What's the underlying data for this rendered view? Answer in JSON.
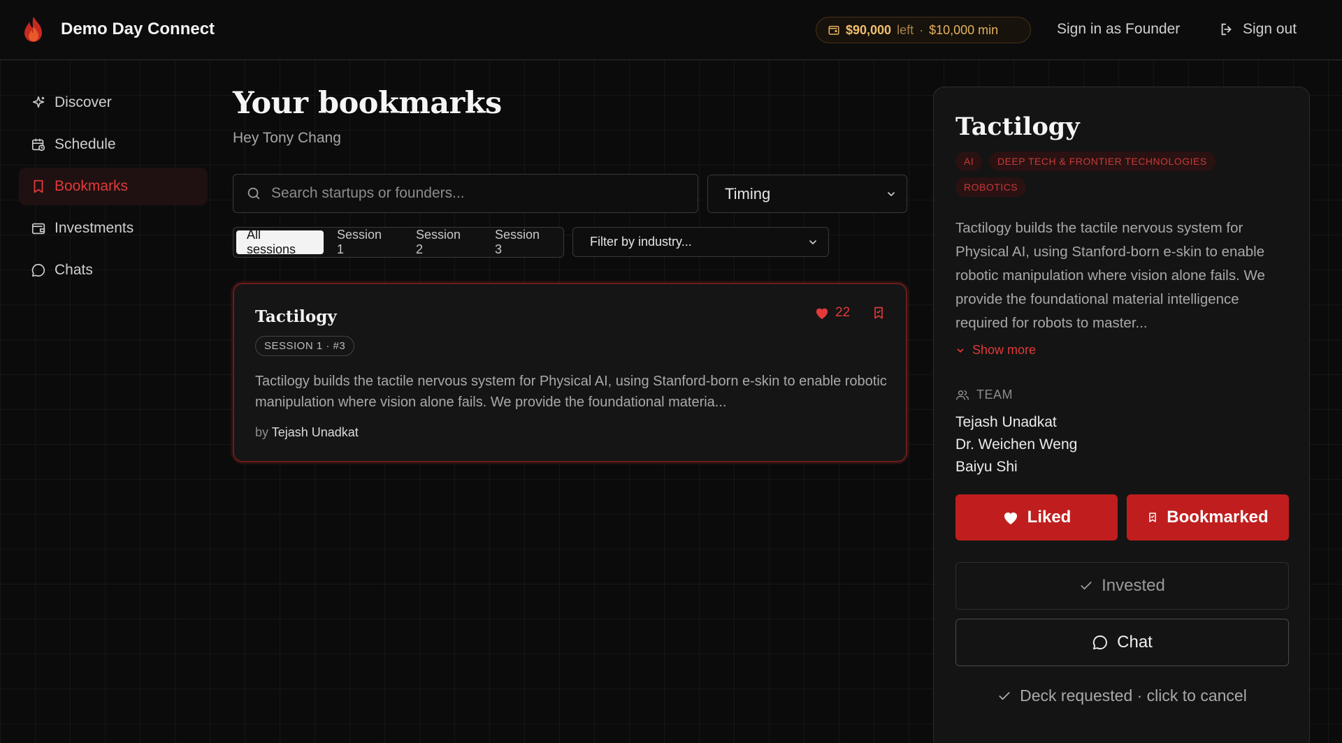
{
  "app": {
    "title": "Demo Day Connect"
  },
  "header": {
    "budget_left": "$90,000",
    "budget_left_word": "left",
    "budget_sep": "·",
    "budget_min": "$10,000 min",
    "sign_in_founder": "Sign in as Founder",
    "sign_out": "Sign out"
  },
  "sidebar": {
    "items": [
      {
        "label": "Discover",
        "icon": "sparkles-icon"
      },
      {
        "label": "Schedule",
        "icon": "calendar-clock-icon"
      },
      {
        "label": "Bookmarks",
        "icon": "bookmark-icon",
        "active": true
      },
      {
        "label": "Investments",
        "icon": "wallet-icon"
      },
      {
        "label": "Chats",
        "icon": "chat-bubble-icon"
      }
    ]
  },
  "main": {
    "title": "Your bookmarks",
    "greeting": "Hey Tony Chang",
    "search_placeholder": "Search startups or founders...",
    "timing_select": "Timing",
    "sessions": [
      "All sessions",
      "Session 1",
      "Session 2",
      "Session 3"
    ],
    "industry_select": "Filter by industry..."
  },
  "card": {
    "title": "Tactilogy",
    "badge": "SESSION 1 · #3",
    "likes": "22",
    "description": "Tactilogy builds the tactile nervous system for Physical AI, using Stanford-born e-skin to enable robotic manipulation where vision alone fails. We provide the foundational materia...",
    "by_prefix": "by",
    "founder": "Tejash Unadkat"
  },
  "panel": {
    "title": "Tactilogy",
    "tags": [
      "AI",
      "DEEP TECH & FRONTIER TECHNOLOGIES",
      "ROBOTICS"
    ],
    "description": "Tactilogy builds the tactile nervous system for Physical AI, using Stanford-born e-skin to enable robotic manipulation where vision alone fails. We provide the foundational material intelligence required for robots to master...",
    "show_more": "Show more",
    "team_label": "TEAM",
    "team": [
      "Tejash Unadkat",
      "Dr. Weichen Weng",
      "Baiyu Shi"
    ],
    "liked": "Liked",
    "bookmarked": "Bookmarked",
    "invested": "Invested",
    "chat": "Chat",
    "deck": "Deck requested · click to cancel"
  },
  "colors": {
    "accent": "#c01e1e",
    "accent_text": "#e03a3a",
    "budget": "#f0c06e"
  }
}
